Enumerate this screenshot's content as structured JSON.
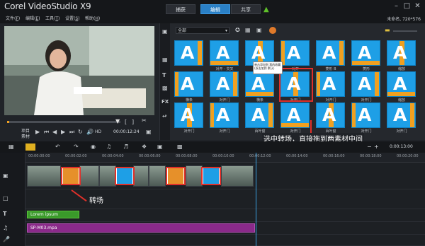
{
  "app": {
    "title": "Corel VideoStudio X9",
    "tabs": [
      "捕获",
      "编辑",
      "共享"
    ],
    "active_tab": "编辑",
    "project_info": "未命名, 720*576",
    "menu": [
      {
        "label": "文件",
        "key": "F"
      },
      {
        "label": "编辑",
        "key": "E"
      },
      {
        "label": "工具",
        "key": "T"
      },
      {
        "label": "设置",
        "key": "S"
      },
      {
        "label": "帮助",
        "key": "H"
      }
    ]
  },
  "preview": {
    "mode_project": "项目",
    "mode_clip": "素材",
    "hd_label": "HD",
    "timecode": "00:00:12:24",
    "progress": 0.02
  },
  "library": {
    "dropdown": "全部",
    "thumbs": [
      {
        "label": ""
      },
      {
        "label": "对开 - 交叉"
      },
      {
        "label": "交叉"
      },
      {
        "label": "对开"
      },
      {
        "label": "菱形 B"
      },
      {
        "label": "菱形"
      },
      {
        "label": "缩放"
      },
      {
        "label": "横条"
      },
      {
        "label": "对开门"
      },
      {
        "label": "横条"
      },
      {
        "label": "对开门"
      },
      {
        "label": "对开门"
      },
      {
        "label": "对开门"
      },
      {
        "label": "缩放"
      },
      {
        "label": "对开门"
      },
      {
        "label": "对开门"
      },
      {
        "label": "百叶窗"
      },
      {
        "label": "对开门"
      },
      {
        "label": "百叶窗"
      },
      {
        "label": "对开门"
      },
      {
        "label": "对开门"
      }
    ],
    "tooltip": "单击添加到 我的收藏 (双击加到 默认)"
  },
  "annotations": {
    "library_tip": "选中转场，直接拖到两素材中间",
    "timeline_tip": "转场"
  },
  "timeline": {
    "timecode": "0:00:13:00",
    "ruler": [
      "00:00:00:00",
      "00:00:02:00",
      "00:00:04:00",
      "00:00:06:00",
      "00:00:08:00",
      "00:00:10:00",
      "00:00:12:00",
      "00:00:14:00",
      "00:00:16:00",
      "00:00:18:00",
      "00:00:20:00"
    ],
    "title_clip": "Lorem ipsum",
    "audio_clip": "SP-M03.mpa"
  },
  "colors": {
    "accent": "#2a80c6",
    "highlight": "#e0302a",
    "transition": "#1e9fe6",
    "title_track": "#3a9a2a",
    "audio_track": "#8a2a8a"
  }
}
